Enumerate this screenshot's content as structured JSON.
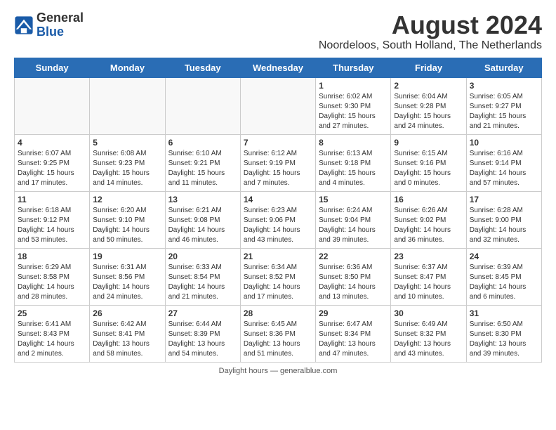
{
  "header": {
    "logo_line1": "General",
    "logo_line2": "Blue",
    "month_year": "August 2024",
    "location": "Noordeloos, South Holland, The Netherlands"
  },
  "weekdays": [
    "Sunday",
    "Monday",
    "Tuesday",
    "Wednesday",
    "Thursday",
    "Friday",
    "Saturday"
  ],
  "weeks": [
    [
      {
        "day": "",
        "info": ""
      },
      {
        "day": "",
        "info": ""
      },
      {
        "day": "",
        "info": ""
      },
      {
        "day": "",
        "info": ""
      },
      {
        "day": "1",
        "info": "Sunrise: 6:02 AM\nSunset: 9:30 PM\nDaylight: 15 hours and 27 minutes."
      },
      {
        "day": "2",
        "info": "Sunrise: 6:04 AM\nSunset: 9:28 PM\nDaylight: 15 hours and 24 minutes."
      },
      {
        "day": "3",
        "info": "Sunrise: 6:05 AM\nSunset: 9:27 PM\nDaylight: 15 hours and 21 minutes."
      }
    ],
    [
      {
        "day": "4",
        "info": "Sunrise: 6:07 AM\nSunset: 9:25 PM\nDaylight: 15 hours and 17 minutes."
      },
      {
        "day": "5",
        "info": "Sunrise: 6:08 AM\nSunset: 9:23 PM\nDaylight: 15 hours and 14 minutes."
      },
      {
        "day": "6",
        "info": "Sunrise: 6:10 AM\nSunset: 9:21 PM\nDaylight: 15 hours and 11 minutes."
      },
      {
        "day": "7",
        "info": "Sunrise: 6:12 AM\nSunset: 9:19 PM\nDaylight: 15 hours and 7 minutes."
      },
      {
        "day": "8",
        "info": "Sunrise: 6:13 AM\nSunset: 9:18 PM\nDaylight: 15 hours and 4 minutes."
      },
      {
        "day": "9",
        "info": "Sunrise: 6:15 AM\nSunset: 9:16 PM\nDaylight: 15 hours and 0 minutes."
      },
      {
        "day": "10",
        "info": "Sunrise: 6:16 AM\nSunset: 9:14 PM\nDaylight: 14 hours and 57 minutes."
      }
    ],
    [
      {
        "day": "11",
        "info": "Sunrise: 6:18 AM\nSunset: 9:12 PM\nDaylight: 14 hours and 53 minutes."
      },
      {
        "day": "12",
        "info": "Sunrise: 6:20 AM\nSunset: 9:10 PM\nDaylight: 14 hours and 50 minutes."
      },
      {
        "day": "13",
        "info": "Sunrise: 6:21 AM\nSunset: 9:08 PM\nDaylight: 14 hours and 46 minutes."
      },
      {
        "day": "14",
        "info": "Sunrise: 6:23 AM\nSunset: 9:06 PM\nDaylight: 14 hours and 43 minutes."
      },
      {
        "day": "15",
        "info": "Sunrise: 6:24 AM\nSunset: 9:04 PM\nDaylight: 14 hours and 39 minutes."
      },
      {
        "day": "16",
        "info": "Sunrise: 6:26 AM\nSunset: 9:02 PM\nDaylight: 14 hours and 36 minutes."
      },
      {
        "day": "17",
        "info": "Sunrise: 6:28 AM\nSunset: 9:00 PM\nDaylight: 14 hours and 32 minutes."
      }
    ],
    [
      {
        "day": "18",
        "info": "Sunrise: 6:29 AM\nSunset: 8:58 PM\nDaylight: 14 hours and 28 minutes."
      },
      {
        "day": "19",
        "info": "Sunrise: 6:31 AM\nSunset: 8:56 PM\nDaylight: 14 hours and 24 minutes."
      },
      {
        "day": "20",
        "info": "Sunrise: 6:33 AM\nSunset: 8:54 PM\nDaylight: 14 hours and 21 minutes."
      },
      {
        "day": "21",
        "info": "Sunrise: 6:34 AM\nSunset: 8:52 PM\nDaylight: 14 hours and 17 minutes."
      },
      {
        "day": "22",
        "info": "Sunrise: 6:36 AM\nSunset: 8:50 PM\nDaylight: 14 hours and 13 minutes."
      },
      {
        "day": "23",
        "info": "Sunrise: 6:37 AM\nSunset: 8:47 PM\nDaylight: 14 hours and 10 minutes."
      },
      {
        "day": "24",
        "info": "Sunrise: 6:39 AM\nSunset: 8:45 PM\nDaylight: 14 hours and 6 minutes."
      }
    ],
    [
      {
        "day": "25",
        "info": "Sunrise: 6:41 AM\nSunset: 8:43 PM\nDaylight: 14 hours and 2 minutes."
      },
      {
        "day": "26",
        "info": "Sunrise: 6:42 AM\nSunset: 8:41 PM\nDaylight: 13 hours and 58 minutes."
      },
      {
        "day": "27",
        "info": "Sunrise: 6:44 AM\nSunset: 8:39 PM\nDaylight: 13 hours and 54 minutes."
      },
      {
        "day": "28",
        "info": "Sunrise: 6:45 AM\nSunset: 8:36 PM\nDaylight: 13 hours and 51 minutes."
      },
      {
        "day": "29",
        "info": "Sunrise: 6:47 AM\nSunset: 8:34 PM\nDaylight: 13 hours and 47 minutes."
      },
      {
        "day": "30",
        "info": "Sunrise: 6:49 AM\nSunset: 8:32 PM\nDaylight: 13 hours and 43 minutes."
      },
      {
        "day": "31",
        "info": "Sunrise: 6:50 AM\nSunset: 8:30 PM\nDaylight: 13 hours and 39 minutes."
      }
    ]
  ],
  "footer": {
    "daylight_label": "Daylight hours",
    "source_text": "generalblue.com"
  }
}
